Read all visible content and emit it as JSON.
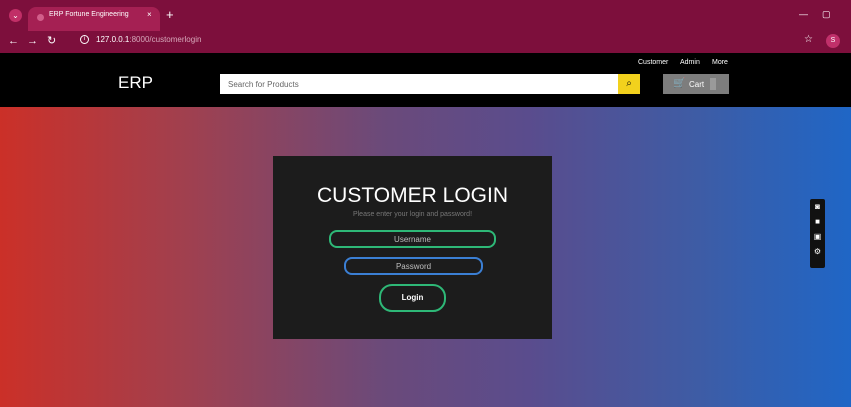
{
  "browser": {
    "tab_title": "ERP Fortune Engineering",
    "tab_close": "×",
    "new_tab": "+",
    "url_host": "127.0.0.1",
    "url_path": ":8000/customerlogin",
    "minimize": "—",
    "restore": "▢",
    "profile_initial": "S"
  },
  "header": {
    "brand": "ERP",
    "search_placeholder": "Search for Products",
    "cart_label": "Cart",
    "nav": [
      "Customer",
      "Admin",
      "More"
    ]
  },
  "login": {
    "title": "CUSTOMER LOGIN",
    "subtitle": "Please enter your login and password!",
    "username_placeholder": "Username",
    "password_placeholder": "Password",
    "button": "Login"
  },
  "colors": {
    "browser_chrome": "#7d0f3c",
    "search_button": "#f2d11d",
    "username_border": "#2eb877",
    "password_border": "#3b7fd4"
  },
  "icons": [
    "tab-menu-icon",
    "favicon-icon",
    "back-icon",
    "forward-icon",
    "reload-icon",
    "info-icon",
    "star-icon",
    "search-icon",
    "cart-icon",
    "camera-icon",
    "video-icon",
    "copy-icon",
    "gear-icon"
  ]
}
